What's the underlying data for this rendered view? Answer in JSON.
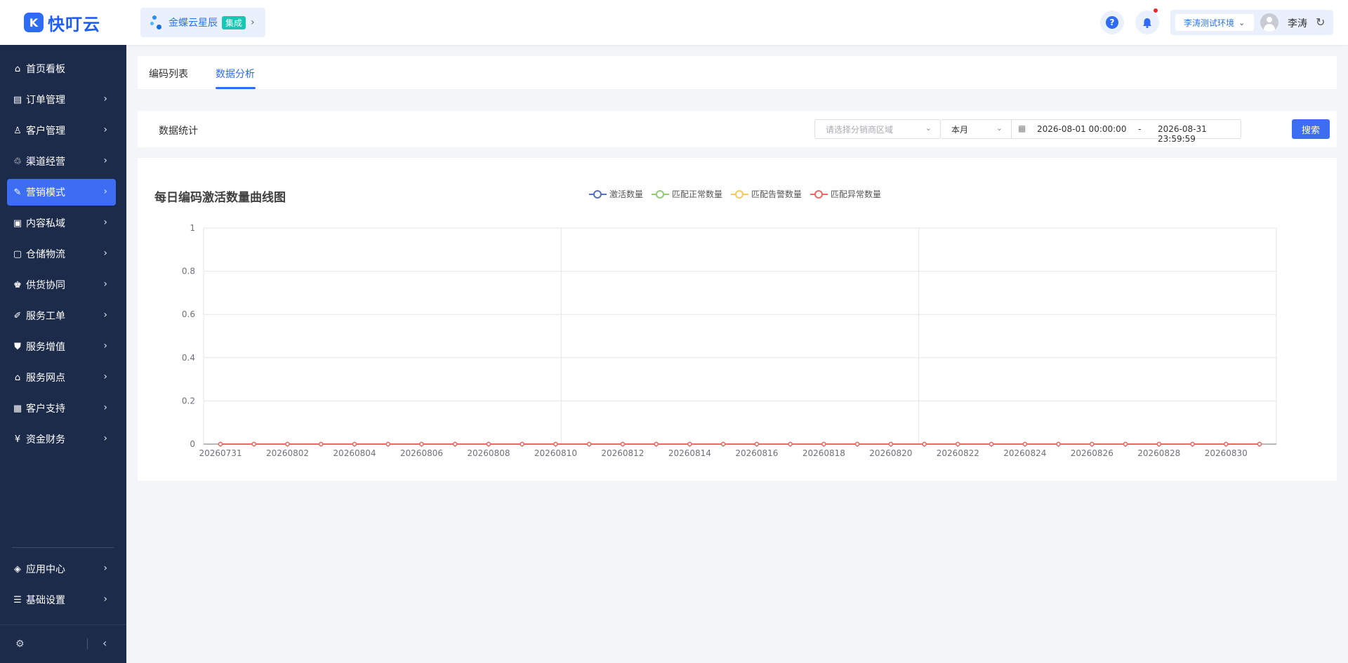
{
  "header": {
    "logo_text": "快叮云",
    "logo_mark": "K",
    "integration": {
      "name": "金蝶云星辰",
      "badge": "集成",
      "chevron": "›"
    },
    "help_label": "?",
    "env_select": "李涛测试环境",
    "username": "李涛",
    "icons": [
      "help-icon",
      "bell-icon",
      "avatar-icon",
      "refresh-icon"
    ]
  },
  "sidebar": {
    "items": [
      {
        "label": "首页看板",
        "icon": "⌂",
        "chevron": ""
      },
      {
        "label": "订单管理",
        "icon": "▤",
        "chevron": "›"
      },
      {
        "label": "客户管理",
        "icon": "♙",
        "chevron": "›"
      },
      {
        "label": "渠道经营",
        "icon": "♲",
        "chevron": "›"
      },
      {
        "label": "营销模式",
        "icon": "✎",
        "chevron": "›"
      },
      {
        "label": "内容私域",
        "icon": "▣",
        "chevron": "›"
      },
      {
        "label": "仓储物流",
        "icon": "▢",
        "chevron": "›"
      },
      {
        "label": "供货协同",
        "icon": "♚",
        "chevron": "›"
      },
      {
        "label": "服务工单",
        "icon": "✐",
        "chevron": "›"
      },
      {
        "label": "服务增值",
        "icon": "⛊",
        "chevron": "›"
      },
      {
        "label": "服务网点",
        "icon": "⌂",
        "chevron": "›"
      },
      {
        "label": "客户支持",
        "icon": "▦",
        "chevron": "›"
      },
      {
        "label": "资金财务",
        "icon": "¥",
        "chevron": "›"
      }
    ],
    "bottom_items": [
      {
        "label": "应用中心",
        "icon": "◈",
        "chevron": "›"
      },
      {
        "label": "基础设置",
        "icon": "☰",
        "chevron": "›"
      }
    ],
    "footer_gear": "⚙",
    "footer_collapse": "‹",
    "active_index": 4
  },
  "tabs": [
    {
      "label": "编码列表"
    },
    {
      "label": "数据分析"
    }
  ],
  "active_tab": 1,
  "filter": {
    "title": "数据统计",
    "region_placeholder": "请选择分销商区域",
    "period": "本月",
    "date_start": "2026-08-01 00:00:00",
    "date_sep": "-",
    "date_end": "2026-08-31 23:59:59",
    "search_label": "搜索",
    "calendar_icon": "▦",
    "chevron": "⌄"
  },
  "chart_data": {
    "type": "line",
    "title": "每日编码激活数量曲线图",
    "xlabel": "",
    "ylabel": "",
    "ylim": [
      0,
      1
    ],
    "y_ticks": [
      "0",
      "0.2",
      "0.4",
      "0.6",
      "0.8",
      "1"
    ],
    "legend_position": "top-center",
    "grid": true,
    "x": [
      "20260731",
      "20260801",
      "20260802",
      "20260803",
      "20260804",
      "20260805",
      "20260806",
      "20260807",
      "20260808",
      "20260809",
      "20260810",
      "20260811",
      "20260812",
      "20260813",
      "20260814",
      "20260815",
      "20260816",
      "20260817",
      "20260818",
      "20260819",
      "20260820",
      "20260821",
      "20260822",
      "20260823",
      "20260824",
      "20260825",
      "20260826",
      "20260827",
      "20260828",
      "20260829",
      "20260830",
      "20260831"
    ],
    "x_tick_labels": [
      "20260731",
      "20260802",
      "20260804",
      "20260806",
      "20260808",
      "20260810",
      "20260812",
      "20260814",
      "20260816",
      "20260818",
      "20260820",
      "20260822",
      "20260824",
      "20260826",
      "20260828",
      "20260830"
    ],
    "series": [
      {
        "name": "激活数量",
        "color": "#5470c6",
        "values": [
          0,
          0,
          0,
          0,
          0,
          0,
          0,
          0,
          0,
          0,
          0,
          0,
          0,
          0,
          0,
          0,
          0,
          0,
          0,
          0,
          0,
          0,
          0,
          0,
          0,
          0,
          0,
          0,
          0,
          0,
          0,
          0
        ]
      },
      {
        "name": "匹配正常数量",
        "color": "#91cc75",
        "values": [
          0,
          0,
          0,
          0,
          0,
          0,
          0,
          0,
          0,
          0,
          0,
          0,
          0,
          0,
          0,
          0,
          0,
          0,
          0,
          0,
          0,
          0,
          0,
          0,
          0,
          0,
          0,
          0,
          0,
          0,
          0,
          0
        ]
      },
      {
        "name": "匹配告警数量",
        "color": "#fac858",
        "values": [
          0,
          0,
          0,
          0,
          0,
          0,
          0,
          0,
          0,
          0,
          0,
          0,
          0,
          0,
          0,
          0,
          0,
          0,
          0,
          0,
          0,
          0,
          0,
          0,
          0,
          0,
          0,
          0,
          0,
          0,
          0,
          0
        ]
      },
      {
        "name": "匹配异常数量",
        "color": "#ee6666",
        "values": [
          0,
          0,
          0,
          0,
          0,
          0,
          0,
          0,
          0,
          0,
          0,
          0,
          0,
          0,
          0,
          0,
          0,
          0,
          0,
          0,
          0,
          0,
          0,
          0,
          0,
          0,
          0,
          0,
          0,
          0,
          0,
          0
        ]
      }
    ]
  }
}
